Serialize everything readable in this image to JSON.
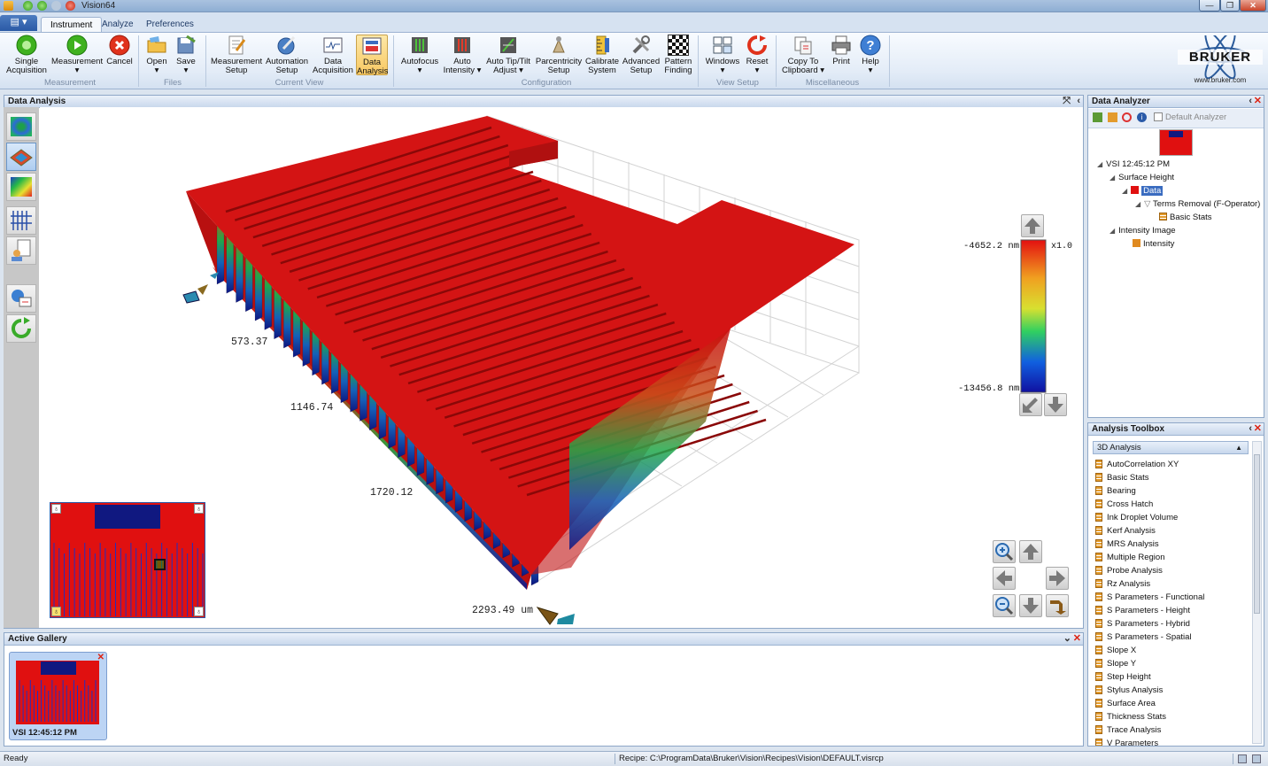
{
  "window": {
    "title": "Vision64"
  },
  "tabs": [
    {
      "label": "Instrument",
      "active": true
    },
    {
      "label": "Analyze",
      "active": false
    },
    {
      "label": "Preferences",
      "active": false
    }
  ],
  "ribbon": {
    "measurement": {
      "group_label": "Measurement",
      "single_acquisition": [
        "Single",
        "Acquisition"
      ],
      "measurement": [
        "Measurement",
        "▾"
      ],
      "cancel": "Cancel"
    },
    "files": {
      "group_label": "Files",
      "open": [
        "Open",
        "▾"
      ],
      "save": [
        "Save",
        "▾"
      ]
    },
    "current_view": {
      "group_label": "Current View",
      "measurement_setup": [
        "Measurement",
        "Setup"
      ],
      "automation_setup": [
        "Automation",
        "Setup"
      ],
      "data_acquisition": [
        "Data",
        "Acquisition"
      ],
      "data_analysis": [
        "Data",
        "Analysis"
      ]
    },
    "configuration": {
      "group_label": "Configuration",
      "autofocus": [
        "Autofocus",
        "▾"
      ],
      "auto_intensity": [
        "Auto",
        "Intensity ▾"
      ],
      "auto_tip_tilt": [
        "Auto Tip/Tilt",
        "Adjust ▾"
      ],
      "parcentricity": [
        "Parcentricity",
        "Setup"
      ],
      "calibrate": [
        "Calibrate",
        "System"
      ],
      "advanced": [
        "Advanced",
        "Setup"
      ],
      "pattern": [
        "Pattern",
        "Finding"
      ]
    },
    "view_setup": {
      "group_label": "View Setup",
      "windows": [
        "Windows",
        "▾"
      ],
      "reset": [
        "Reset",
        "▾"
      ]
    },
    "miscellaneous": {
      "group_label": "Miscellaneous",
      "copy": [
        "Copy To",
        "Clipboard ▾"
      ],
      "print": "Print",
      "help": [
        "Help",
        "▾"
      ]
    }
  },
  "logo": {
    "text": "BRUKER",
    "url": "www.bruker.com"
  },
  "data_analysis": {
    "title": "Data Analysis",
    "axis_labels": [
      "573.37",
      "1146.74",
      "1720.12",
      "2293.49 um"
    ],
    "scale": {
      "max": "-4652.2 nm",
      "min": "-13456.8 nm",
      "zoom": "x1.0"
    }
  },
  "data_analyzer": {
    "title": "Data Analyzer",
    "default_analyzer": "Default Analyzer",
    "tree": [
      {
        "label": "VSI 12:45:12 PM",
        "level": 0
      },
      {
        "label": "Surface Height",
        "level": 1
      },
      {
        "label": "Data",
        "level": 2,
        "selected": true
      },
      {
        "label": "Terms Removal (F-Operator)",
        "level": 3
      },
      {
        "label": "Basic Stats",
        "level": 4
      },
      {
        "label": "Intensity Image",
        "level": 1
      },
      {
        "label": "Intensity",
        "level": 2
      }
    ]
  },
  "analysis_toolbox": {
    "title": "Analysis Toolbox",
    "section": "3D Analysis",
    "items": [
      "AutoCorrelation XY",
      "Basic Stats",
      "Bearing",
      "Cross Hatch",
      "Ink Droplet Volume",
      "Kerf Analysis",
      "MRS Analysis",
      "Multiple Region",
      "Probe Analysis",
      "Rz Analysis",
      "S Parameters - Functional",
      "S Parameters - Height",
      "S Parameters - Hybrid",
      "S Parameters - Spatial",
      "Slope X",
      "Slope Y",
      "Step Height",
      "Stylus Analysis",
      "Surface Area",
      "Thickness Stats",
      "Trace Analysis",
      "V Parameters"
    ]
  },
  "active_gallery": {
    "title": "Active Gallery",
    "thumb_label": "VSI 12:45:12 PM"
  },
  "status": {
    "left": "Ready",
    "recipe": "Recipe: C:\\ProgramData\\Bruker\\Vision\\Recipes\\Vision\\DEFAULT.visrcp"
  }
}
